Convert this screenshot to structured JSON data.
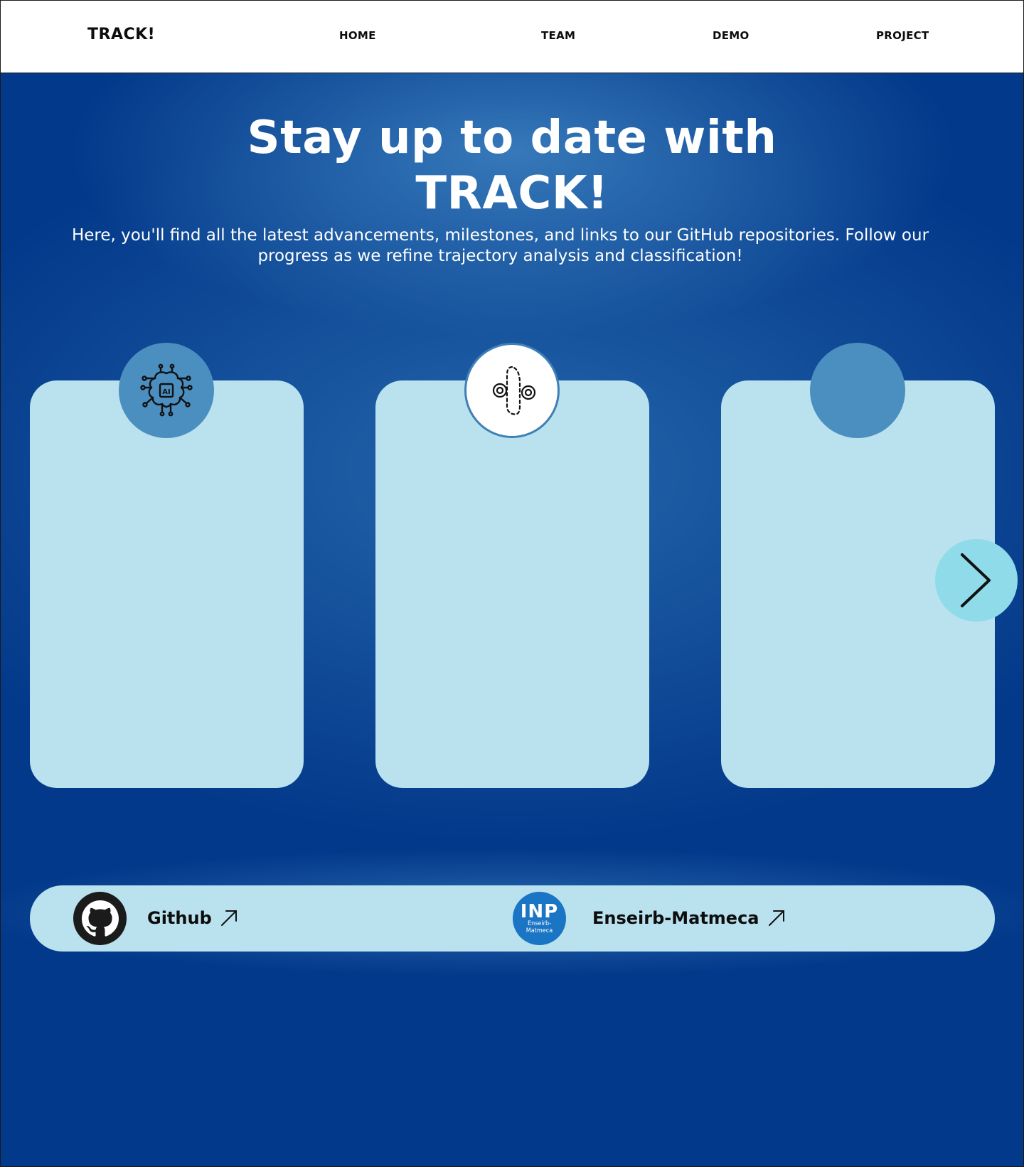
{
  "nav": {
    "brand": "TRACK!",
    "links": [
      "HOME",
      "TEAM",
      "DEMO",
      "PROJECT"
    ]
  },
  "hero": {
    "title_line1": "Stay up to date with",
    "title_line2": "TRACK!",
    "subtitle": "Here, you'll find all the latest advancements, milestones, and links to our GitHub repositories. Follow our progress as we refine trajectory analysis and classification!"
  },
  "cards": [
    {
      "icon": "ai-brain-icon"
    },
    {
      "icon": "trajectory-path-icon"
    },
    {
      "icon": ""
    }
  ],
  "carousel": {
    "next_icon": "chevron-right-icon"
  },
  "links": {
    "github_label": "Github",
    "inp_label": "Enseirb-Matmeca",
    "inp_logo_big": "INP",
    "inp_logo_small_1": "Enseirb-",
    "inp_logo_small_2": "Matmeca"
  },
  "colors": {
    "background": "#03398a",
    "card": "#b9e1ee",
    "badge": "#4a8fc0",
    "next_button": "#8fdbe9"
  }
}
